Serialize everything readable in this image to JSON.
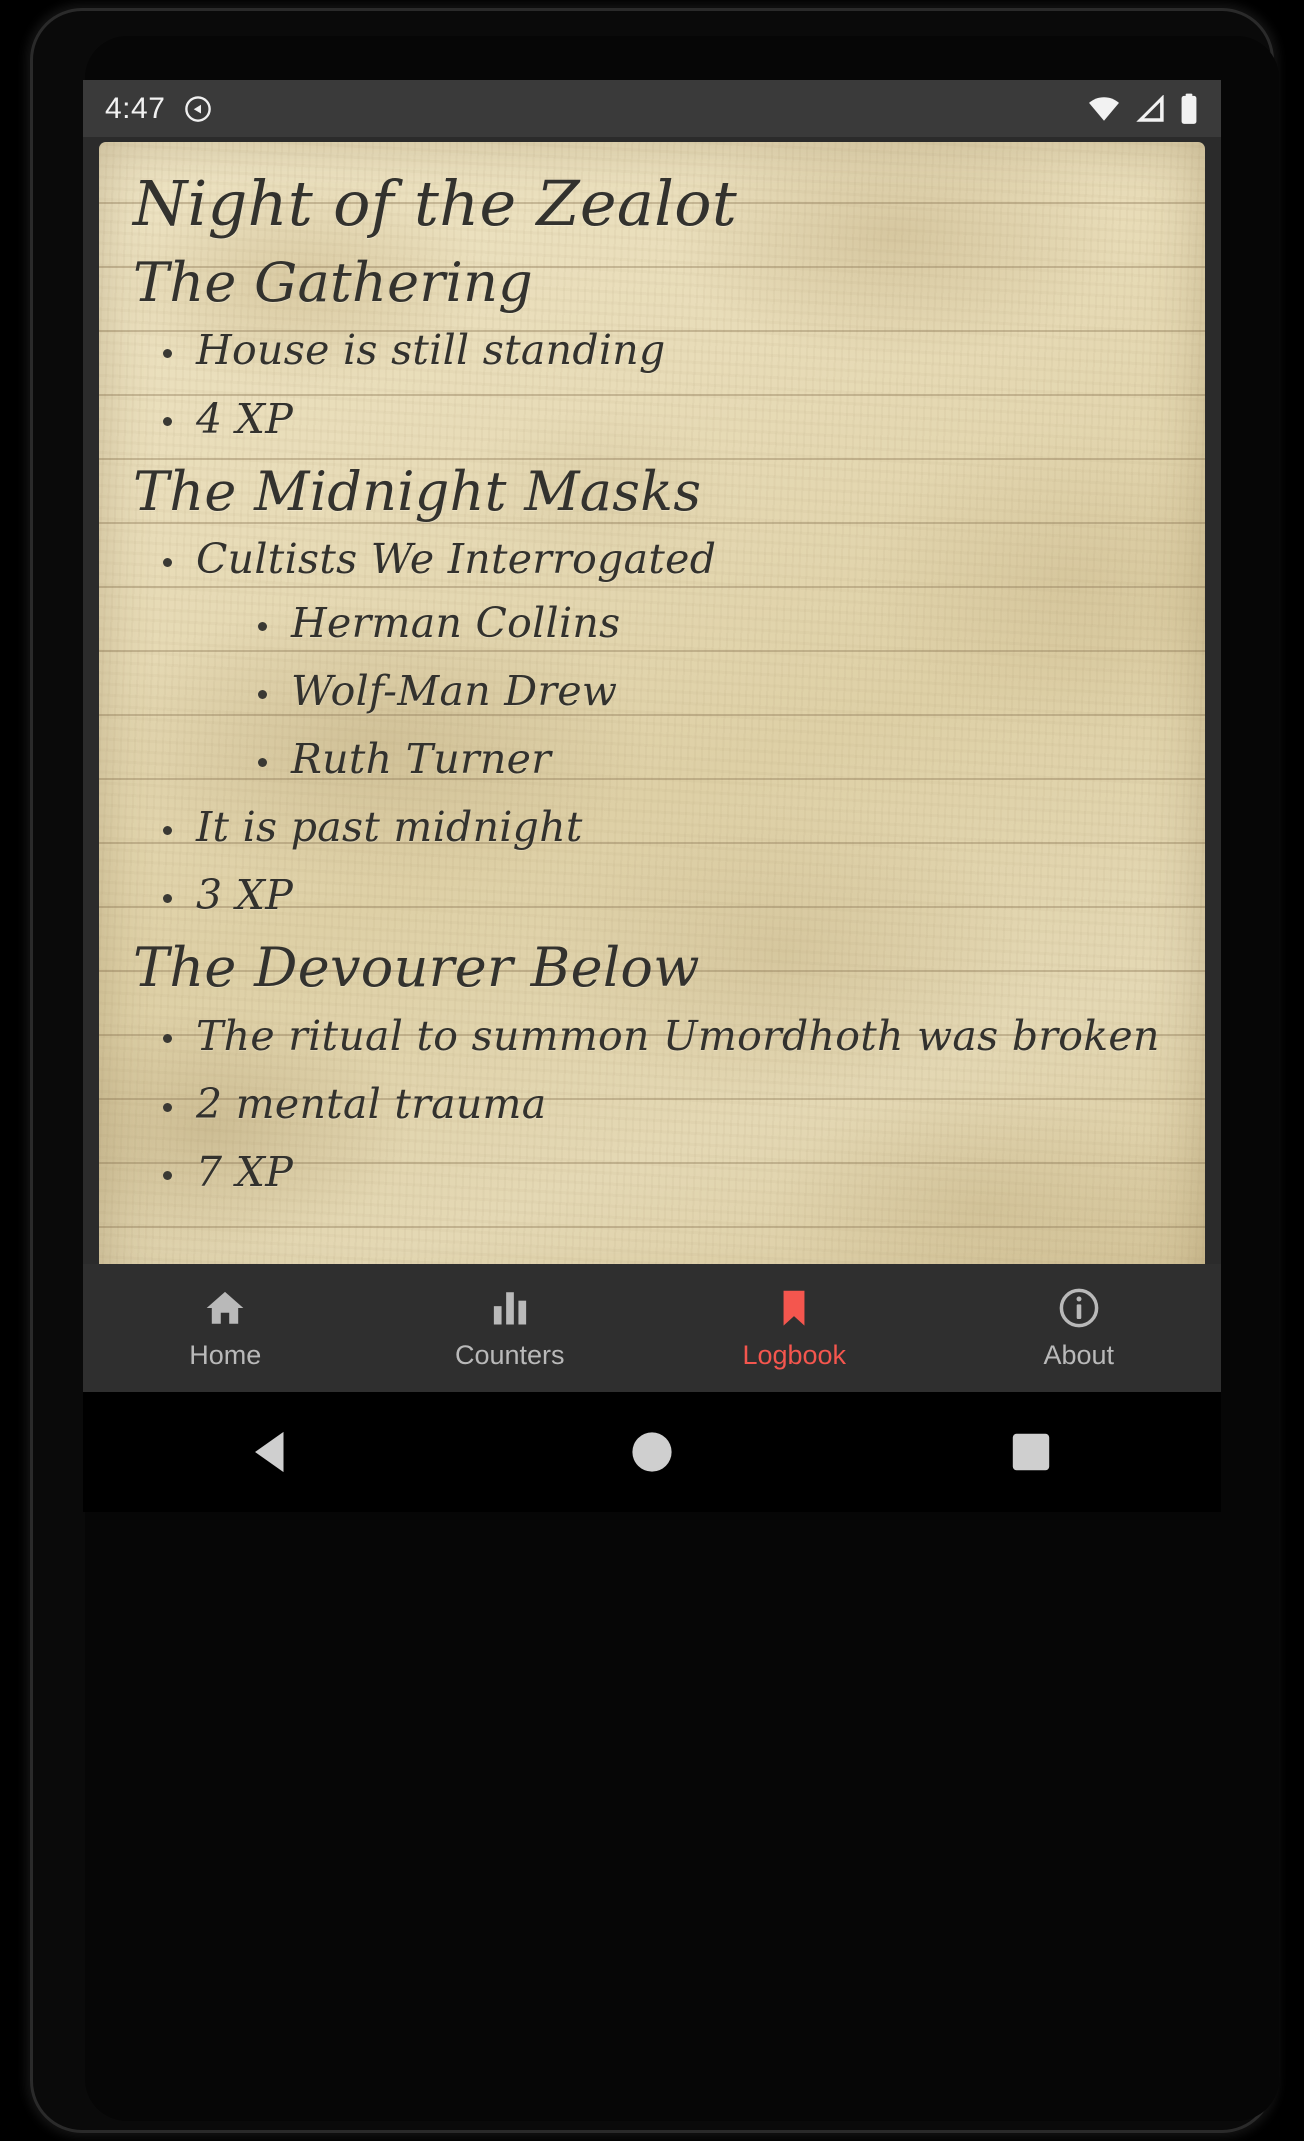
{
  "status_bar": {
    "clock": "4:47",
    "notification_icon": "screen-record-icon",
    "wifi_icon": "wifi-icon",
    "signal_icon": "cellular-signal-icon",
    "battery_icon": "battery-full-icon"
  },
  "logbook": {
    "campaign_title": "Night of the Zealot",
    "scenarios": [
      {
        "title": "The Gathering",
        "entries": [
          {
            "text": "House is still standing"
          },
          {
            "text": "4 XP"
          }
        ]
      },
      {
        "title": "The Midnight Masks",
        "entries": [
          {
            "text": "Cultists We Interrogated",
            "children": [
              {
                "text": "Herman Collins"
              },
              {
                "text": "Wolf-Man Drew"
              },
              {
                "text": "Ruth Turner"
              }
            ]
          },
          {
            "text": "It is past midnight"
          },
          {
            "text": "3 XP"
          }
        ]
      },
      {
        "title": "The Devourer Below",
        "entries": [
          {
            "text": "The ritual to summon Umordhoth was broken"
          },
          {
            "text": "2 mental trauma"
          },
          {
            "text": "7 XP"
          }
        ]
      }
    ]
  },
  "bottom_nav": {
    "active_color": "#f4564e",
    "items": [
      {
        "label": "Home",
        "icon": "home-icon",
        "active": false
      },
      {
        "label": "Counters",
        "icon": "bar-chart-icon",
        "active": false
      },
      {
        "label": "Logbook",
        "icon": "bookmark-icon",
        "active": true
      },
      {
        "label": "About",
        "icon": "info-icon",
        "active": false
      }
    ]
  },
  "system_nav": {
    "back": "back-triangle-icon",
    "home": "home-circle-icon",
    "recents": "recents-square-icon"
  }
}
